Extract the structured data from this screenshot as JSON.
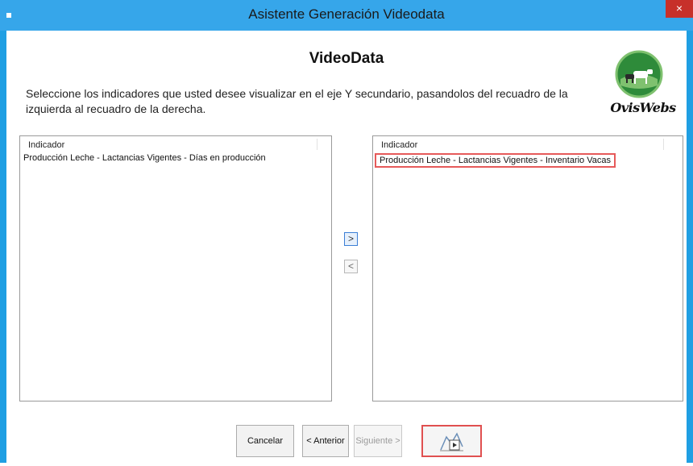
{
  "window": {
    "title": "Asistente Generación Videodata",
    "close_label": "×"
  },
  "heading": "VideoData",
  "instructions": "Seleccione los indicadores que usted desee visualizar en el eje Y secundario, pasandolos del recuadro de la izquierda al recuadro de la derecha.",
  "logo": {
    "text": "OvisWebs"
  },
  "left_list": {
    "header": "Indicador",
    "items": [
      "Producción Leche - Lactancias Vigentes - Días en producción"
    ]
  },
  "right_list": {
    "header": "Indicador",
    "items": [
      "Producción Leche - Lactancias Vigentes - Inventario Vacas"
    ]
  },
  "move_buttons": {
    "right_label": ">",
    "left_label": "<"
  },
  "footer": {
    "cancel_label": "Cancelar",
    "prev_label": "< Anterior",
    "next_label": "Siguiente >",
    "video_icon": "chart-play-icon"
  },
  "colors": {
    "titlebar": "#36a6ea",
    "highlight": "#e65a5a",
    "logo_green": "#2e8b3a"
  }
}
